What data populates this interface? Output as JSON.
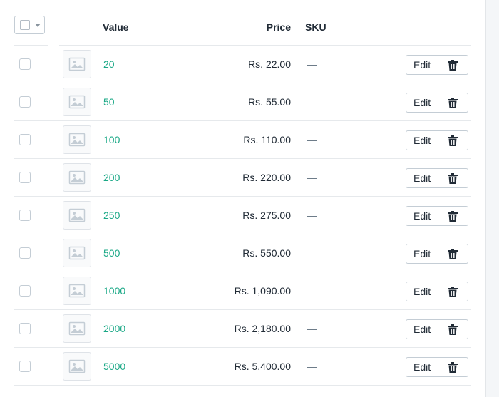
{
  "table": {
    "headers": {
      "value": "Value",
      "price": "Price",
      "sku": "SKU"
    },
    "edit_label": "Edit",
    "rows": [
      {
        "value": "20",
        "price": "Rs. 22.00",
        "sku": "—"
      },
      {
        "value": "50",
        "price": "Rs. 55.00",
        "sku": "—"
      },
      {
        "value": "100",
        "price": "Rs. 110.00",
        "sku": "—"
      },
      {
        "value": "200",
        "price": "Rs. 220.00",
        "sku": "—"
      },
      {
        "value": "250",
        "price": "Rs. 275.00",
        "sku": "—"
      },
      {
        "value": "500",
        "price": "Rs. 550.00",
        "sku": "—"
      },
      {
        "value": "1000",
        "price": "Rs. 1,090.00",
        "sku": "—"
      },
      {
        "value": "2000",
        "price": "Rs. 2,180.00",
        "sku": "—"
      },
      {
        "value": "5000",
        "price": "Rs. 5,400.00",
        "sku": "—"
      }
    ]
  },
  "colors": {
    "link": "#1aa886",
    "text": "#212b36",
    "border": "#c4cdd5"
  },
  "icons": {
    "thumbnail": "image-placeholder-icon",
    "delete": "trash-icon",
    "bulk_caret": "chevron-down-icon"
  }
}
